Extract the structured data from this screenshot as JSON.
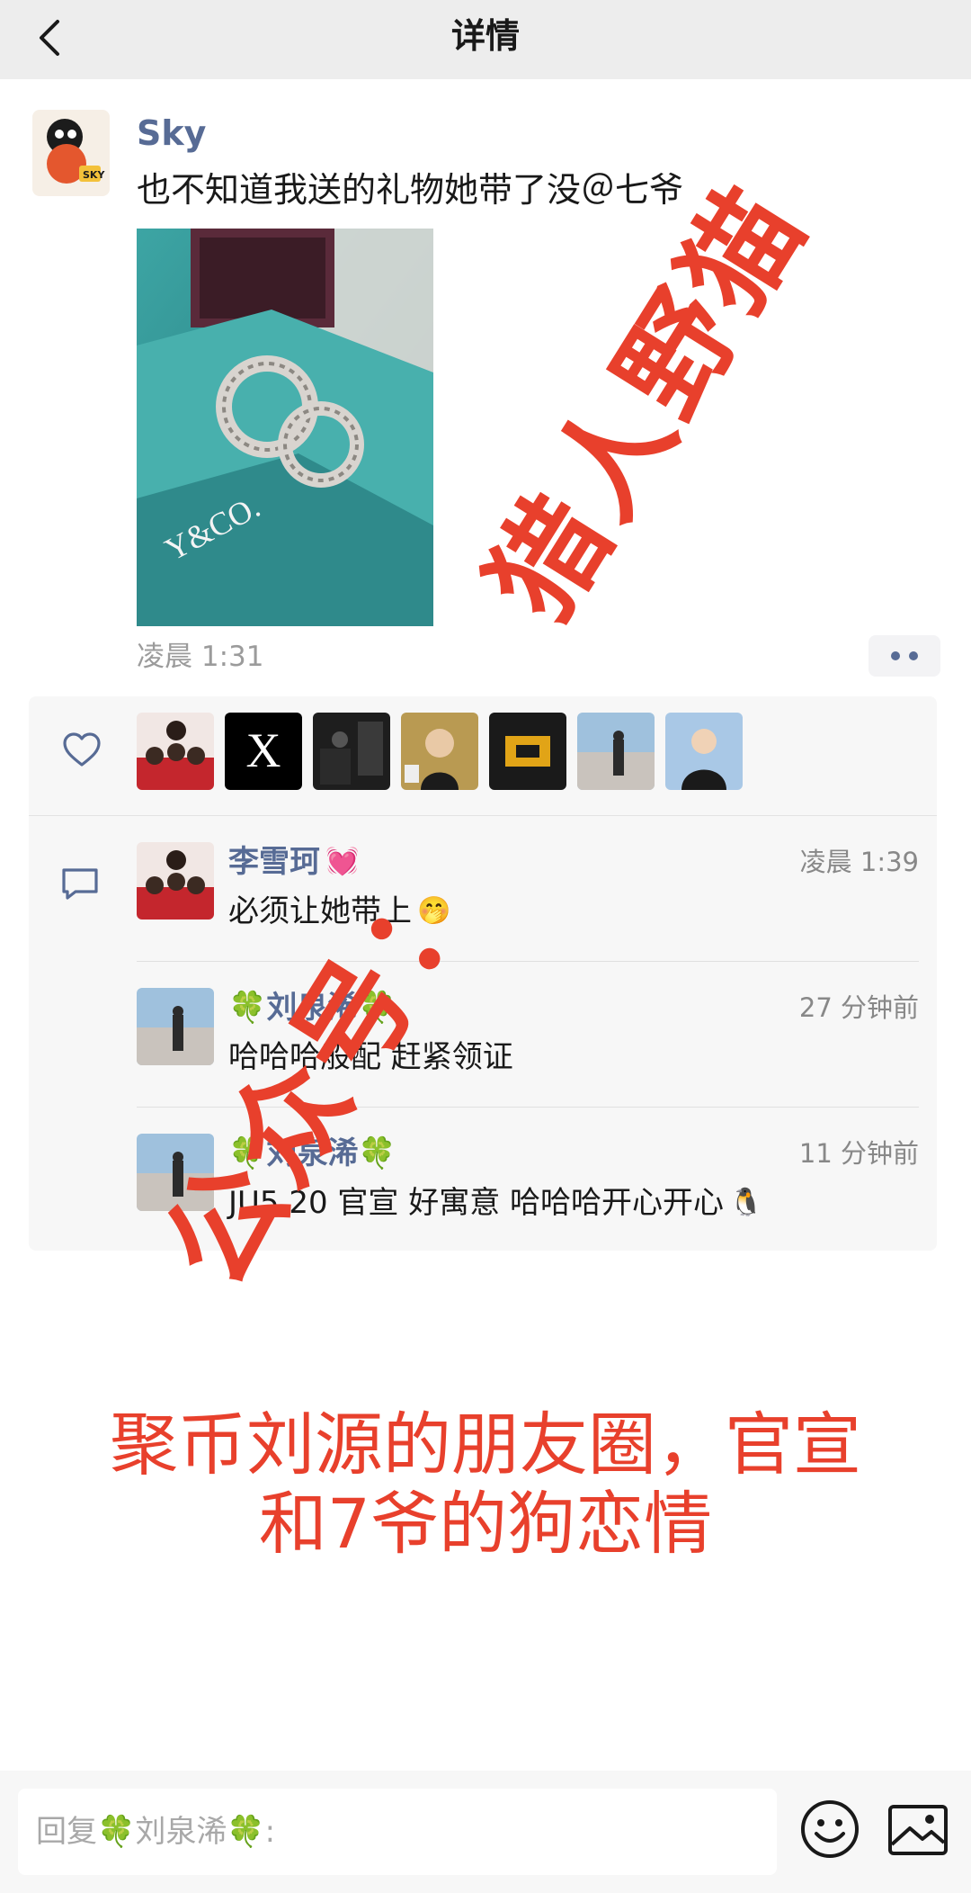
{
  "nav": {
    "title": "详情",
    "back_icon": "chevron-left-icon"
  },
  "post": {
    "author": "Sky",
    "text": "也不知道我送的礼物她带了没＠七爷",
    "image_caption": "Y&CO.",
    "time": "凌晨 1:31"
  },
  "likes": {
    "icon": "heart-outline-icon",
    "likers": [
      "family-photo",
      "X",
      "dark-room",
      "speaker",
      "gold-text",
      "street",
      "portrait"
    ]
  },
  "comments": [
    {
      "name": "李雪珂",
      "name_suffix": "💓",
      "time": "凌晨 1:39",
      "text": "必须让她带上",
      "text_suffix": "🤭"
    },
    {
      "name": "🍀刘泉浠🍀",
      "time": "27 分钟前",
      "text": "哈哈哈般配 赶紧领证"
    },
    {
      "name": "🍀刘泉浠🍀",
      "time": "11 分钟前",
      "text": "JU5.20 官宣 好寓意 哈哈哈开心开心",
      "text_suffix": "🐧"
    }
  ],
  "overlay": {
    "watermark_right": "猎人野猫",
    "watermark_left": "公众号：",
    "caption_line1": "聚币刘源的朋友圈，官宣",
    "caption_line2": "和7爷的狗恋情"
  },
  "reply": {
    "placeholder": "回复🍀刘泉浠🍀:"
  },
  "colors": {
    "link": "#576b95",
    "watermark": "#e8402c",
    "panel": "#f7f7f7"
  }
}
